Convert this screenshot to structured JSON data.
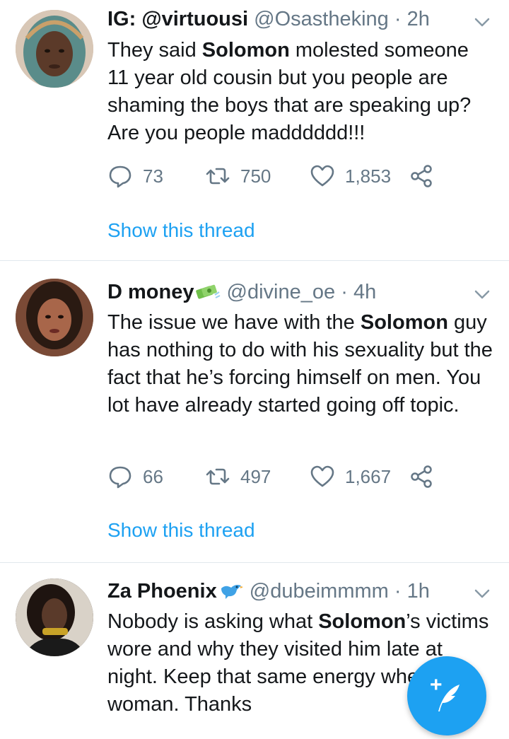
{
  "tweets": [
    {
      "display_name": "IG: @virtuousi",
      "handle": "@Osastheking",
      "dot": "·",
      "time": "2h",
      "text_parts": [
        "They said ",
        "Solomon",
        " molested someone 11 year old cousin but you people are shaming the boys that are speaking up? Are you people madddddd!!!"
      ],
      "replies": "73",
      "retweets": "750",
      "likes": "1,853",
      "thread_link": "Show this thread"
    },
    {
      "display_name": "D money",
      "badge_icon": "money-bag-emoji",
      "handle": "@divine_oe",
      "dot": "·",
      "time": "4h",
      "text_parts": [
        "The issue we have with the ",
        "Solomon",
        " guy has nothing to do with his sexuality but the fact that he’s forcing himself on men. You lot have already started going off topic."
      ],
      "replies": "66",
      "retweets": "497",
      "likes": "1,667",
      "thread_link": "Show this thread"
    },
    {
      "display_name": "Za Phoenix",
      "badge_icon": "bird-emoji",
      "handle": "@dubeimmmm",
      "dot": "·",
      "time": "1h",
      "text_parts": [
        "Nobody is asking what ",
        "Solomon",
        "’s victims wore and why they visited him late at night. Keep that same energy when it’s a woman. Thanks"
      ]
    }
  ],
  "compose": {
    "icon": "compose-feather-icon",
    "plus": "+"
  },
  "colors": {
    "accent": "#1da1f2",
    "muted": "#657786",
    "divider": "#e1e8ed"
  }
}
